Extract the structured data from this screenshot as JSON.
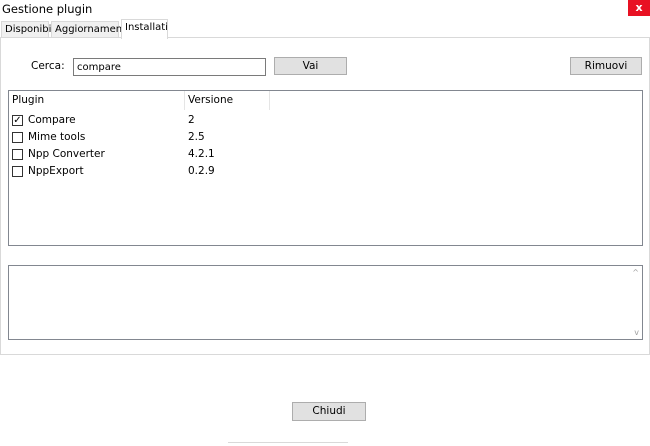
{
  "window": {
    "title": "Gestione plugin",
    "close_glyph": "x"
  },
  "tabs": [
    {
      "label": "Disponibili"
    },
    {
      "label": "Aggiornamenti"
    },
    {
      "label": "Installati",
      "active": true
    }
  ],
  "search": {
    "label": "Cerca:",
    "value": "compare"
  },
  "buttons": {
    "go": "Vai",
    "remove": "Rimuovi",
    "close": "Chiudi"
  },
  "plugin_list": {
    "columns": [
      "Plugin",
      "Versione"
    ],
    "rows": [
      {
        "name": "Compare",
        "version": "2",
        "checked": true
      },
      {
        "name": "Mime tools",
        "version": "2.5",
        "checked": false
      },
      {
        "name": "Npp Converter",
        "version": "4.2.1",
        "checked": false
      },
      {
        "name": "NppExport",
        "version": "0.2.9",
        "checked": false
      }
    ]
  },
  "description": {
    "text": ""
  },
  "icons": {
    "checkmark": "✓",
    "scroll_up": "^",
    "scroll_down": "v"
  }
}
